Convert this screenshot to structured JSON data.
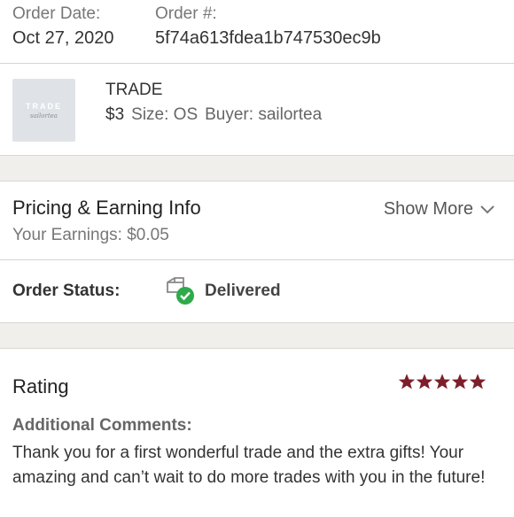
{
  "order": {
    "date_label": "Order Date:",
    "date_value": "Oct 27, 2020",
    "number_label": "Order #:",
    "number_value": "5f74a613fdea1b747530ec9b"
  },
  "item": {
    "thumbnail_text": "TRADE",
    "thumbnail_subtext": "sailortea",
    "name": "TRADE",
    "price": "$3",
    "size": "Size: OS",
    "buyer": "Buyer: sailortea"
  },
  "pricing": {
    "title": "Pricing & Earning Info",
    "earnings": "Your Earnings: $0.05",
    "show_more": "Show More"
  },
  "status": {
    "label": "Order Status:",
    "value": "Delivered",
    "icon": "package-delivered-icon"
  },
  "rating": {
    "title": "Rating",
    "stars": 5,
    "comments_label": "Additional Comments:",
    "comments": "Thank you for a first wonderful trade and the extra gifts! Your amazing and can’t wait to do more trades with you in the future!"
  },
  "colors": {
    "star": "#7d1f2b",
    "check": "#2eaa4a",
    "gap": "#f0efec"
  }
}
